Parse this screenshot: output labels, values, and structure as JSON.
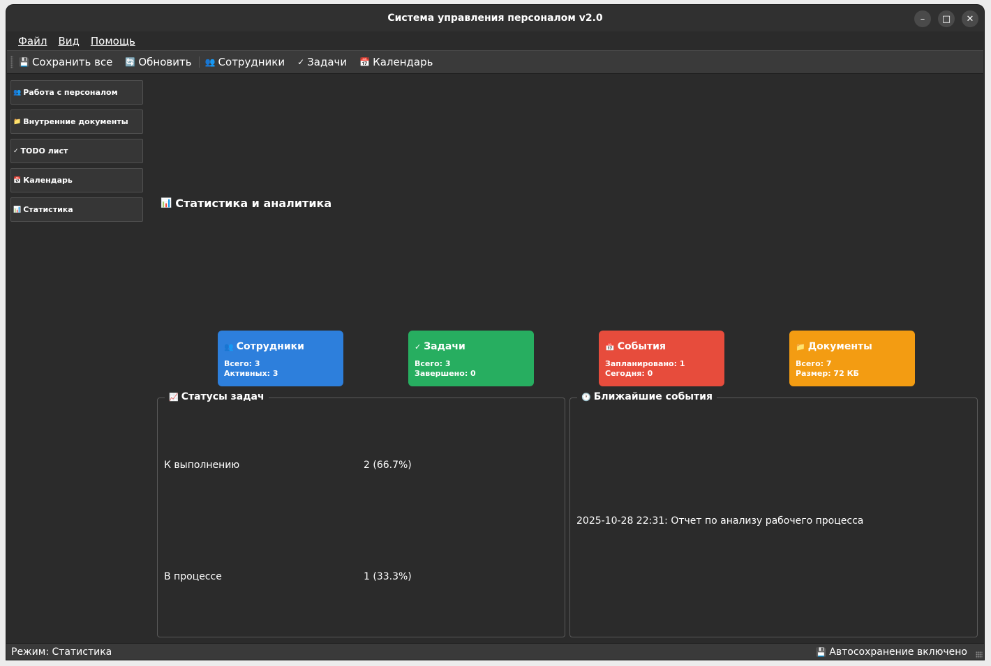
{
  "window": {
    "title": "Система управления персоналом v2.0",
    "controls": {
      "minimize": "–",
      "maximize": "□",
      "close": "✕"
    }
  },
  "menubar": {
    "items": [
      {
        "label": "Файл"
      },
      {
        "label": "Вид"
      },
      {
        "label": "Помощь"
      }
    ]
  },
  "toolbar": {
    "save_all": {
      "icon": "💾",
      "label": "Сохранить все"
    },
    "refresh": {
      "icon": "🔄",
      "label": "Обновить"
    },
    "employees": {
      "icon": "👥",
      "label": "Сотрудники"
    },
    "tasks": {
      "icon": "✓",
      "label": "Задачи"
    },
    "calendar": {
      "icon": "📅",
      "label": "Календарь"
    }
  },
  "sidebar": {
    "items": [
      {
        "icon": "👥",
        "label": "Работа с персоналом"
      },
      {
        "icon": "📁",
        "label": "Внутренние документы"
      },
      {
        "icon": "✓",
        "label": "TODO лист"
      },
      {
        "icon": "📅",
        "label": "Календарь"
      },
      {
        "icon": "📊",
        "label": "Статистика"
      }
    ]
  },
  "main": {
    "title": {
      "icon": "📊",
      "text": "Статистика и аналитика"
    },
    "cards": [
      {
        "icon": "👥",
        "title": "Сотрудники",
        "line1": "Всего: 3",
        "line2": "Активных: 3",
        "color": "#2d7fdc"
      },
      {
        "icon": "✓",
        "title": "Задачи",
        "line1": "Всего: 3",
        "line2": "Завершено: 0",
        "color": "#27ae60"
      },
      {
        "icon": "📅",
        "title": "События",
        "line1": "Запланировано: 1",
        "line2": "Сегодня: 0",
        "color": "#e74c3c"
      },
      {
        "icon": "📁",
        "title": "Документы",
        "line1": "Всего: 7",
        "line2": "Размер: 72 КБ",
        "color": "#f39c12"
      }
    ],
    "task_statuses": {
      "icon": "📈",
      "title": "Статусы задач",
      "rows": [
        {
          "label": "К выполнению",
          "value": "2 (66.7%)"
        },
        {
          "label": "В процессе",
          "value": "1 (33.3%)"
        }
      ]
    },
    "upcoming_events": {
      "icon": "🕐",
      "title": "Ближайшие события",
      "items": [
        "2025-10-28 22:31: Отчет по анализу рабочего процесса"
      ]
    }
  },
  "statusbar": {
    "mode": "Режим: Статистика",
    "autosave_icon": "💾",
    "autosave": "Автосохранение включено"
  }
}
